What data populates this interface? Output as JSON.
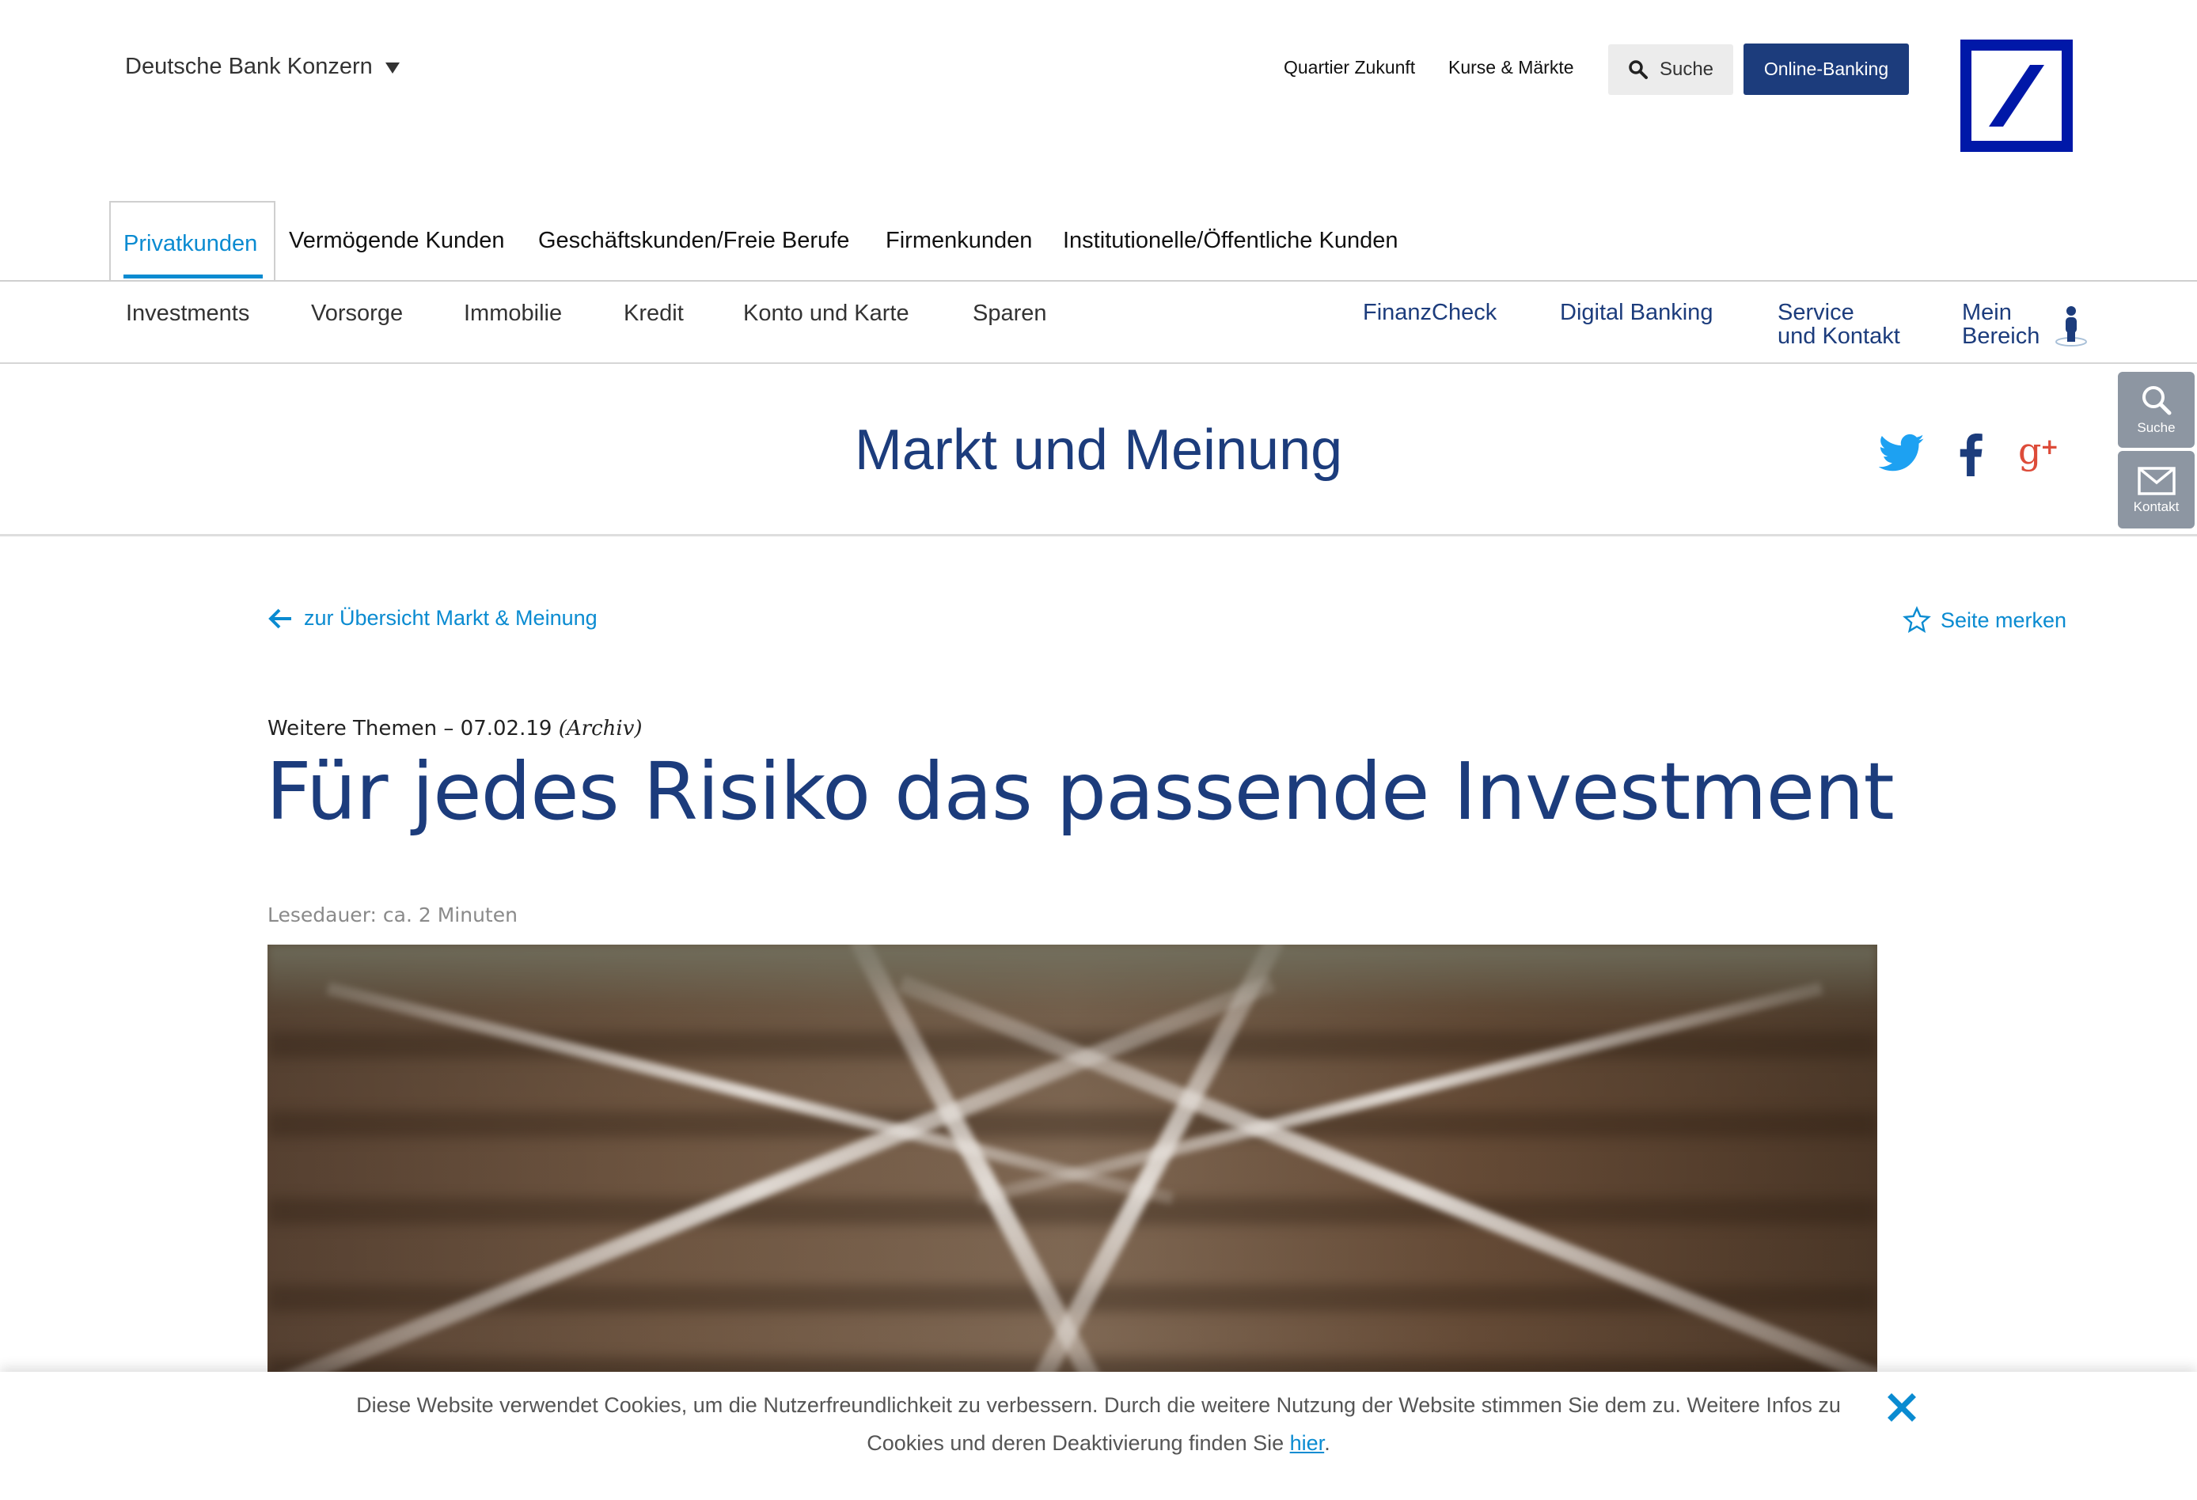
{
  "top_bar": {
    "konzern_label": "Deutsche Bank Konzern",
    "links": [
      "Quartier Zukunft",
      "Kurse & Märkte"
    ],
    "search_label": "Suche",
    "online_banking_label": "Online-Banking"
  },
  "segments": [
    "Privatkunden",
    "Vermögende Kunden",
    "Geschäftskunden/Freie Berufe",
    "Firmenkunden",
    "Institutionelle/Öffentliche Kunden"
  ],
  "sub_nav": {
    "left": [
      "Investments",
      "Vorsorge",
      "Immobilie",
      "Kredit",
      "Konto und Karte",
      "Sparen"
    ],
    "finanzcheck": "FinanzCheck",
    "digital_banking": "Digital Banking",
    "service_line1": "Service",
    "service_line2": "und Kontakt",
    "mein_line1": "Mein",
    "mein_line2": "Bereich"
  },
  "page_title": "Markt und Meinung",
  "side_tools": {
    "search": "Suche",
    "contact": "Kontakt"
  },
  "article": {
    "back_link": "zur Übersicht Markt & Meinung",
    "bookmark": "Seite merken",
    "meta_prefix": "Weitere Themen – 07.02.19",
    "meta_archive": "(Archiv)",
    "headline": "Für jedes Risiko das passende Investment",
    "reading_time": "Lesedauer: ca. 2 Minuten"
  },
  "cookie": {
    "text": "Diese Website verwendet Cookies, um die Nutzerfreundlichkeit zu verbessern. Durch die weitere Nutzung der Website stimmen Sie dem zu. Weitere Infos zu Cookies und deren Deaktivierung finden Sie",
    "link": "hier",
    "end": "."
  },
  "colors": {
    "brand_blue": "#1c3c7c",
    "link_blue": "#0a8bd1",
    "logo_blue": "#0018a8",
    "twitter": "#1da1f2",
    "google_plus": "#dd4b39"
  },
  "icons": [
    "chevron-down-icon",
    "search-icon",
    "user-icon",
    "twitter-icon",
    "facebook-icon",
    "google-plus-icon",
    "mail-icon",
    "arrow-left-icon",
    "star-icon",
    "close-icon"
  ]
}
